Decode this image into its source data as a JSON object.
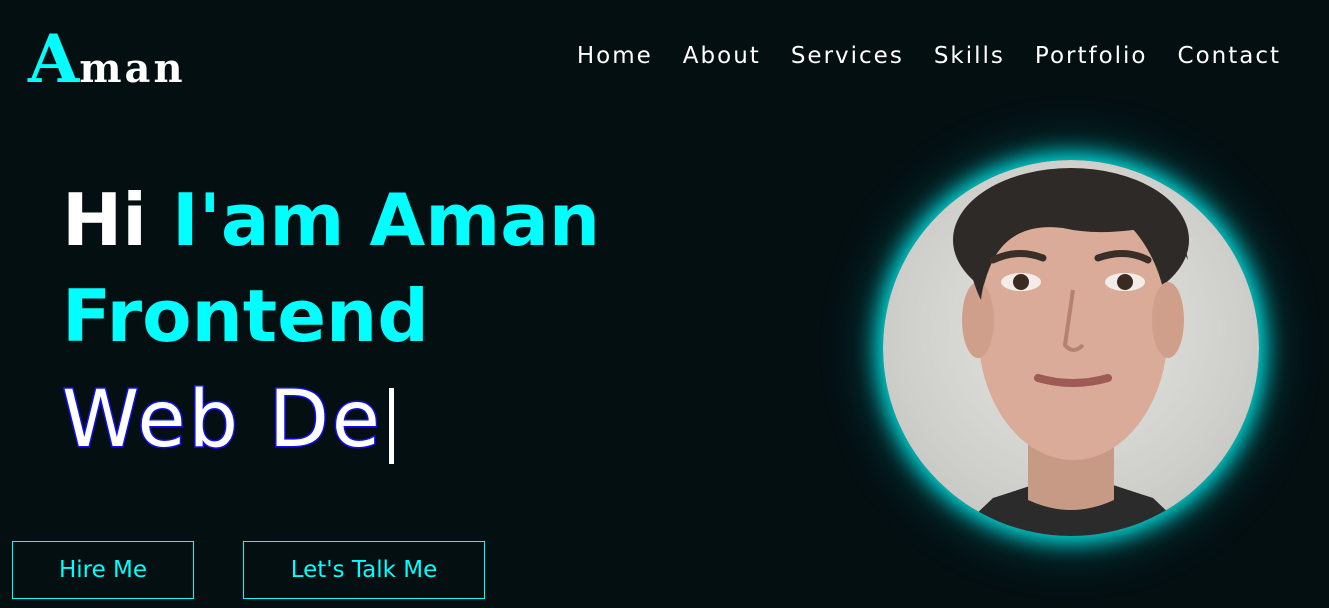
{
  "header": {
    "logo_first": "A",
    "logo_rest": "man",
    "nav": [
      {
        "label": "Home"
      },
      {
        "label": "About"
      },
      {
        "label": "Services"
      },
      {
        "label": "Skills"
      },
      {
        "label": "Portfolio"
      },
      {
        "label": "Contact"
      }
    ]
  },
  "hero": {
    "greeting": "Hi",
    "name": "I'am Aman",
    "role_line": "Frontend",
    "typing_text": "Web De",
    "buttons": {
      "hire": "Hire Me",
      "talk": "Let's Talk Me"
    }
  },
  "colors": {
    "background": "#040f12",
    "accent": "#00ffff",
    "typing_stroke": "#1515ee",
    "text": "#ffffff"
  },
  "icons": {
    "profile": "profile-photo"
  }
}
